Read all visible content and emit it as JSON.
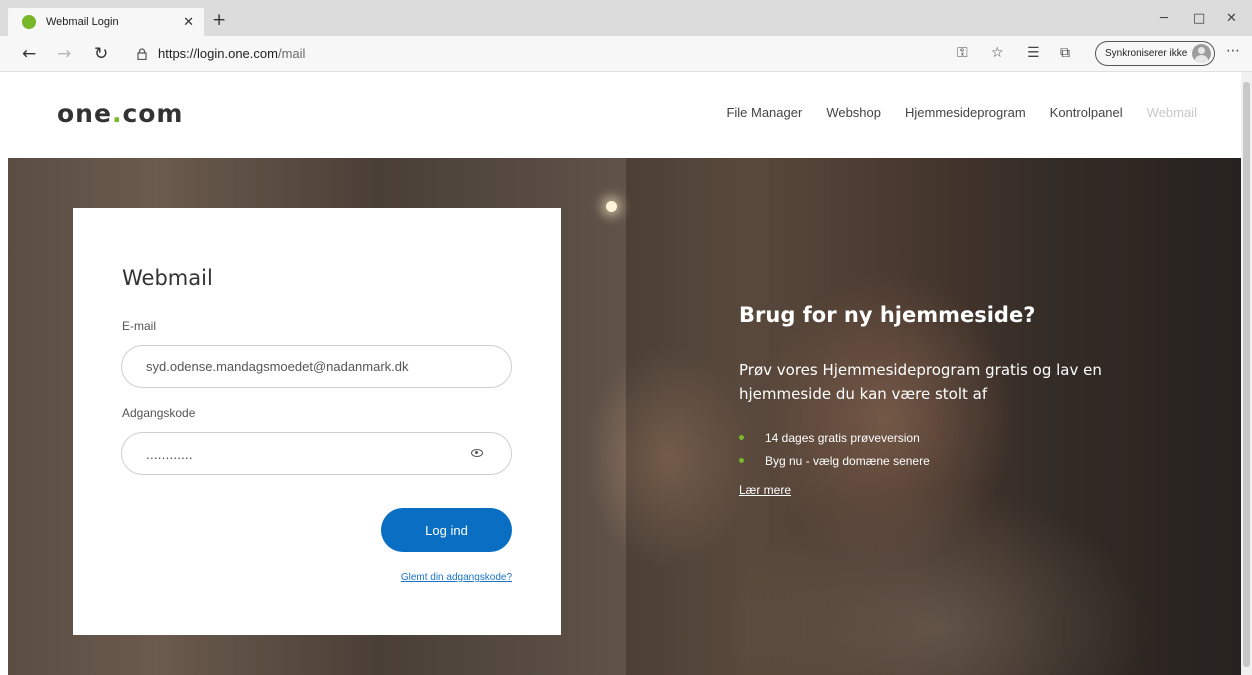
{
  "browser": {
    "tab_title": "Webmail Login",
    "url_host": "https://login.one.com",
    "url_path": "/mail",
    "sync_label": "Synkroniserer ikke"
  },
  "site": {
    "logo_prefix": "one",
    "logo_dot": ".",
    "logo_suffix": "com",
    "nav": [
      "File Manager",
      "Webshop",
      "Hjemmesideprogram",
      "Kontrolpanel",
      "Webmail"
    ]
  },
  "login": {
    "title": "Webmail",
    "email_label": "E-mail",
    "email_value": "syd.odense.mandagsmoedet@nadanmark.dk",
    "password_label": "Adgangskode",
    "password_value": "............",
    "submit_label": "Log ind",
    "forgot_label": "Glemt din adgangskode?"
  },
  "promo": {
    "title": "Brug for ny hjemmeside?",
    "body": "Prøv vores Hjemmesideprogram gratis og lav en hjemmeside du kan være stolt af",
    "bullets": [
      "14 dages gratis prøveversion",
      "Byg nu - vælg domæne senere"
    ],
    "learn_more": "Lær mere"
  },
  "colors": {
    "brand_green": "#76b82a",
    "button_blue": "#0a6fc2"
  }
}
